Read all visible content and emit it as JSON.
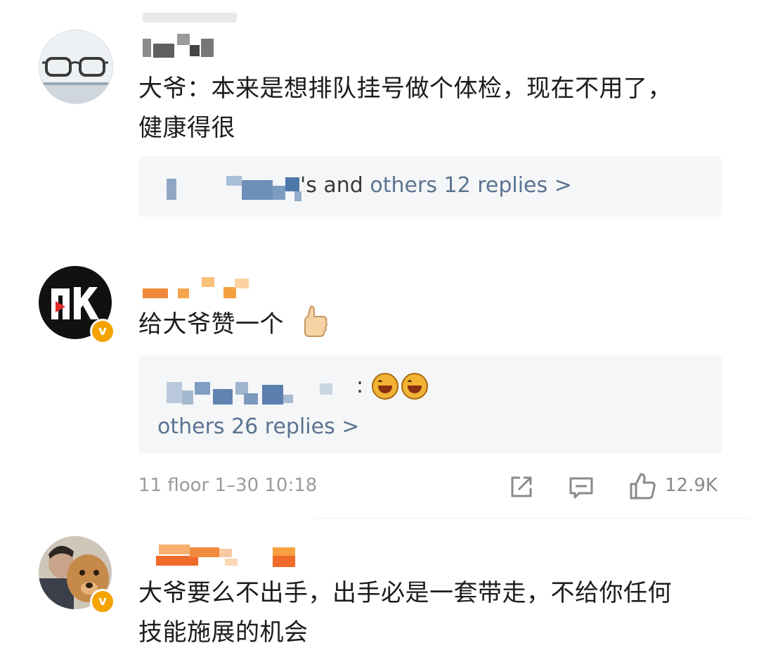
{
  "comments": [
    {
      "text_line1": "大爷：本来是想排队挂号做个体检，现在不用了，",
      "text_line2": "健康得很",
      "reply_summary_name_suffix": "'s and ",
      "reply_summary_link": "others 12 replies >"
    },
    {
      "text": "给大爷赞一个",
      "verified_badge": "v",
      "reply_colon": ":",
      "reply_summary_link": "others 26 replies >",
      "floor_info": "11 floor 1–30 10:18",
      "like_count": "12.9K"
    },
    {
      "text_line1": "大爷要么不出手，出手必是一套带走，不给你任何",
      "text_line2": "技能施展的机会",
      "verified_badge": "v"
    }
  ],
  "colors": {
    "link_blue": "#5a7390",
    "meta_gray": "#9b9b9b",
    "reply_bg": "#f5f6f8",
    "badge_orange": "#f4a300",
    "username_orange": "#f08a3a"
  },
  "icons": [
    "glasses-avatar-icon",
    "news-logo-avatar-icon",
    "dog-photo-avatar-icon",
    "thumbs-up-emoji-icon",
    "laughing-emoji-icon",
    "share-icon",
    "comment-icon",
    "like-icon"
  ]
}
